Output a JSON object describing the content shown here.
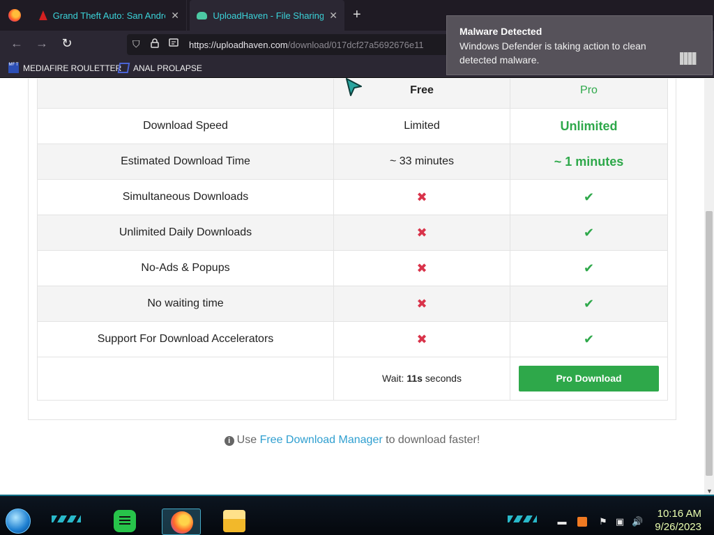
{
  "browser": {
    "tabs": [
      {
        "title": "Grand Theft Auto: San Andreas",
        "active": false
      },
      {
        "title": "UploadHaven - File Sharing Ma",
        "active": true
      }
    ],
    "url": {
      "host": "https://uploadhaven.com",
      "path": "/download/017dcf27a5692676e11"
    },
    "bookmarks": [
      {
        "label": "MEDIAFIRE ROULETTER",
        "icon_text": "MF T"
      },
      {
        "label": "ANAL PROLAPSE"
      }
    ]
  },
  "notification": {
    "title": "Malware Detected",
    "body": "Windows Defender is taking action to clean detected malware."
  },
  "table": {
    "headers": {
      "free": "Free",
      "pro": "Pro"
    },
    "rows": [
      {
        "feature": "Download Speed",
        "free": "Limited",
        "pro": "Unlimited"
      },
      {
        "feature": "Estimated Download Time",
        "free": "~ 33 minutes",
        "pro": "~ 1 minutes"
      },
      {
        "feature": "Simultaneous Downloads",
        "free": "✖",
        "pro": "✔"
      },
      {
        "feature": "Unlimited Daily Downloads",
        "free": "✖",
        "pro": "✔"
      },
      {
        "feature": "No-Ads & Popups",
        "free": "✖",
        "pro": "✔"
      },
      {
        "feature": "No waiting time",
        "free": "✖",
        "pro": "✔"
      },
      {
        "feature": "Support For Download Accelerators",
        "free": "✖",
        "pro": "✔"
      }
    ],
    "wait": {
      "prefix": "Wait: ",
      "seconds": "11s",
      "suffix": " seconds"
    },
    "pro_button": "Pro Download"
  },
  "fdm": {
    "prefix": "Use ",
    "link": "Free Download Manager",
    "suffix": " to download faster!"
  },
  "taskbar": {
    "time": "10:16 AM",
    "date": "9/26/2023"
  },
  "colors": {
    "pro_green": "#2ea84a",
    "cross_red": "#d9334a",
    "link_blue": "#2f9fd0",
    "tab_text": "#3bd3d9"
  }
}
